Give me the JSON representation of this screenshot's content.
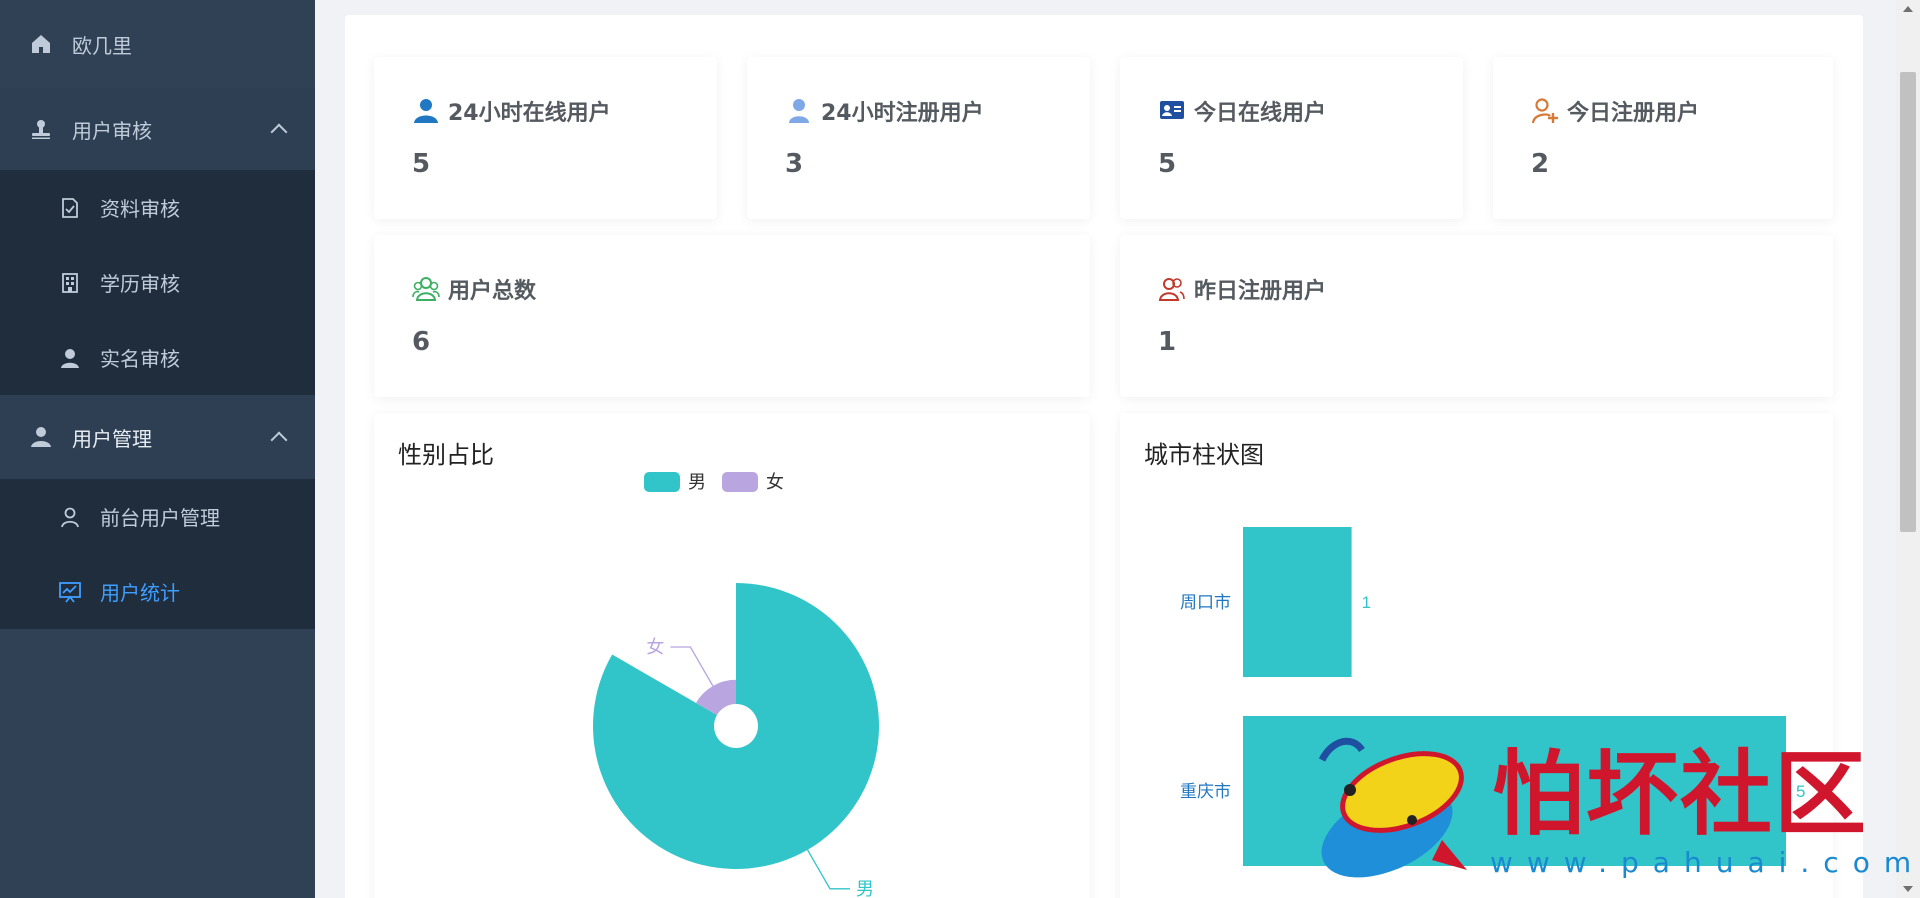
{
  "sidebar": {
    "home": {
      "label": "欧几里"
    },
    "groups": [
      {
        "label": "用户审核",
        "items": [
          {
            "label": "资料审核"
          },
          {
            "label": "学历审核"
          },
          {
            "label": "实名审核"
          }
        ]
      },
      {
        "label": "用户管理",
        "items": [
          {
            "label": "前台用户管理"
          },
          {
            "label": "用户统计",
            "active": true
          }
        ]
      }
    ]
  },
  "stats": [
    {
      "title": "24小时在线用户",
      "value": "5",
      "icon": "user-solid-icon",
      "color": "#1f78c1"
    },
    {
      "title": "24小时注册用户",
      "value": "3",
      "icon": "user-light-icon",
      "color": "#7ea8e6"
    },
    {
      "title": "今日在线用户",
      "value": "5",
      "icon": "id-card-icon",
      "color": "#1e4fa0"
    },
    {
      "title": "今日注册用户",
      "value": "2",
      "icon": "user-add-icon",
      "color": "#d67a3a"
    },
    {
      "title": "用户总数",
      "value": "6",
      "icon": "users-outline-icon",
      "color": "#3bb062"
    },
    {
      "title": "昨日注册用户",
      "value": "1",
      "icon": "users-outline-icon",
      "color": "#c0392b"
    }
  ],
  "charts": {
    "gender": {
      "title": "性别占比"
    },
    "city": {
      "title": "城市柱状图"
    }
  },
  "chart_data": [
    {
      "type": "pie",
      "title": "性别占比",
      "legend": {
        "placement": "top",
        "entries": [
          "男",
          "女"
        ]
      },
      "slices": [
        {
          "name": "男",
          "value": 5,
          "color": "#31c5c9"
        },
        {
          "name": "女",
          "value": 1,
          "color": "#b9a5df"
        }
      ]
    },
    {
      "type": "bar",
      "orientation": "horizontal",
      "title": "城市柱状图",
      "categories": [
        "周口市",
        "重庆市"
      ],
      "values": [
        1,
        5
      ],
      "color": "#31c5c9"
    }
  ],
  "watermark": {
    "brand": "怕坏社区",
    "url": "www.pahuai.com"
  }
}
